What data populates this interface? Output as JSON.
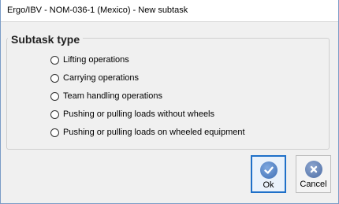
{
  "window": {
    "title": "Ergo/IBV - NOM-036-1 (Mexico) - New subtask"
  },
  "subtask": {
    "heading": "Subtask type",
    "options": [
      {
        "label": "Lifting operations",
        "selected": false
      },
      {
        "label": "Carrying operations",
        "selected": false
      },
      {
        "label": "Team handling operations",
        "selected": false
      },
      {
        "label": "Pushing or pulling loads without wheels",
        "selected": false
      },
      {
        "label": "Pushing or pulling loads on wheeled equipment",
        "selected": false
      }
    ]
  },
  "buttons": {
    "ok": {
      "label": "Ok",
      "icon": "checkmark-icon"
    },
    "cancel": {
      "label": "Cancel",
      "icon": "close-icon"
    }
  },
  "colors": {
    "accent": "#1f70c8",
    "window_bg": "#f0f0f0"
  }
}
